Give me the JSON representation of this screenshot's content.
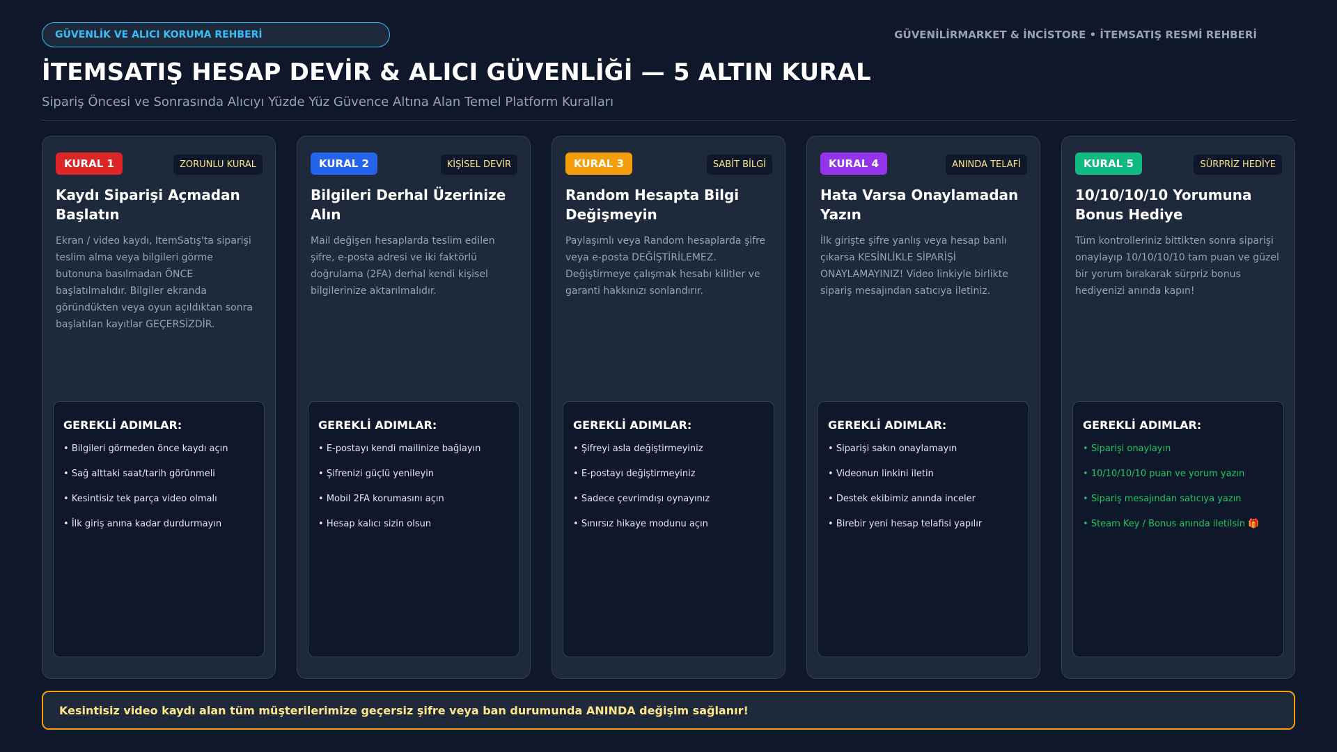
{
  "header": {
    "badge": "GÜVENLİK VE ALICI KORUMA REHBERİ",
    "brand": "GÜVENİLİRMARKET & İNCİSTORE • İTEMSATIŞ RESMİ REHBERİ",
    "title": "İTEMSATIŞ HESAP DEVİR & ALICI GÜVENLİĞİ — 5 ALTIN KURAL",
    "subtitle": "Sipariş Öncesi ve Sonrasında Alıcıyı Yüzde Yüz Güvence Altına Alan Temel Platform Kuralları"
  },
  "colors": {
    "rule1": "#dc2626",
    "rule2": "#2563eb",
    "rule3": "#f59e0b",
    "rule4": "#9333ea",
    "rule5": "#10b981",
    "highlight_steps": "#22c55e",
    "footer_border": "#f59e0b"
  },
  "steps_heading": "GEREKLİ ADIMLAR:",
  "cards": [
    {
      "badge": "KURAL 1",
      "tag": "ZORUNLU KURAL",
      "title": "Kaydı Siparişi Açmadan Başlatın",
      "desc": "Ekran / video kaydı, ItemSatış'ta siparişi teslim alma veya bilgileri görme butonuna basılmadan ÖNCE başlatılmalıdır. Bilgiler ekranda göründükten veya oyun açıldıktan sonra başlatılan kayıtlar GEÇERSİZDİR.",
      "steps": [
        "Bilgileri görmeden önce kaydı açın",
        "Sağ alttaki saat/tarih görünmeli",
        "Kesintisiz tek parça video olmalı",
        "İlk giriş anına kadar durdurmayın"
      ]
    },
    {
      "badge": "KURAL 2",
      "tag": "KİŞİSEL DEVİR",
      "title": "Bilgileri Derhal Üzerinize Alın",
      "desc": "Mail değişen hesaplarda teslim edilen şifre, e-posta adresi ve iki faktörlü doğrulama (2FA) derhal kendi kişisel bilgilerinize aktarılmalıdır.",
      "steps": [
        "E-postayı kendi mailinize bağlayın",
        "Şifrenizi güçlü yenileyin",
        "Mobil 2FA korumasını açın",
        "Hesap kalıcı sizin olsun"
      ]
    },
    {
      "badge": "KURAL 3",
      "tag": "SABİT BİLGİ",
      "title": "Random Hesapta Bilgi Değişmeyin",
      "desc": "Paylaşımlı veya Random hesaplarda şifre veya e-posta DEĞİŞTİRİLEMEZ. Değiştirmeye çalışmak hesabı kilitler ve garanti hakkınızı sonlandırır.",
      "steps": [
        "Şifreyi asla değiştirmeyiniz",
        "E-postayı değiştirmeyiniz",
        "Sadece çevrimdışı oynayınız",
        "Sınırsız hikaye modunu açın"
      ]
    },
    {
      "badge": "KURAL 4",
      "tag": "ANINDA TELAFİ",
      "title": "Hata Varsa Onaylamadan Yazın",
      "desc": "İlk girişte şifre yanlış veya hesap banlı çıkarsa KESİNLİKLE SİPARİŞİ ONAYLAMAYINIZ! Video linkiyle birlikte sipariş mesajından satıcıya iletiniz.",
      "steps": [
        "Siparişi sakın onaylamayın",
        "Videonun linkini iletin",
        "Destek ekibimiz anında inceler",
        "Birebir yeni hesap telafisi yapılır"
      ]
    },
    {
      "badge": "KURAL 5",
      "tag": "SÜRPRİZ HEDİYE",
      "title": "10/10/10/10 Yorumuna Bonus Hediye",
      "desc": "Tüm kontrolleriniz bittikten sonra siparişi onaylayıp 10/10/10/10 tam puan ve güzel bir yorum bırakarak sürpriz bonus hediyenizi anında kapın!",
      "steps": [
        "Siparişi onaylayın",
        "10/10/10/10 puan ve yorum yazın",
        "Sipariş mesajından satıcıya yazın",
        "Steam Key / Bonus anında iletilsin 🎁"
      ]
    }
  ],
  "footer": "Kesintisiz video kaydı alan tüm müşterilerimize geçersiz şifre veya ban durumunda ANINDA değişim sağlanır!"
}
